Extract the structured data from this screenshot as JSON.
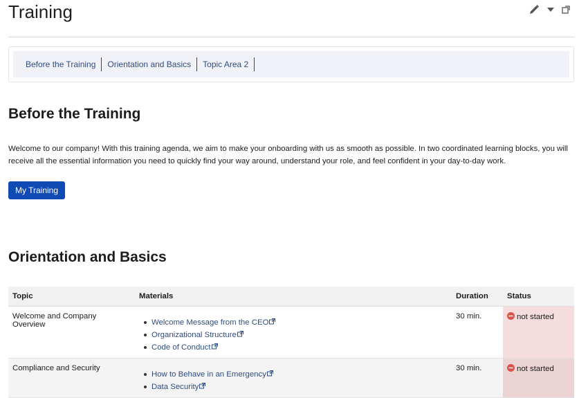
{
  "page": {
    "title": "Training"
  },
  "toc": {
    "items": [
      "Before the Training",
      "Orientation and Basics",
      "Topic Area 2"
    ]
  },
  "before": {
    "heading": "Before the Training",
    "intro": "Welcome to our company! With this training agenda, we aim to make your onboarding with us as smooth as possible. In two coordinated learning blocks, you will receive all the essential information you need to quickly find your way around, understand your role, and feel confident in your day-to-day work.",
    "button_label": "My Training"
  },
  "orientation": {
    "heading": "Orientation and Basics",
    "columns": {
      "topic": "Topic",
      "materials": "Materials",
      "duration": "Duration",
      "status": "Status"
    },
    "rows": [
      {
        "topic": "Welcome and Company Overview",
        "materials": [
          "Welcome Message from the CEO",
          "Organizational Structure",
          "Code of Conduct"
        ],
        "duration": "30 min.",
        "status": "not started"
      },
      {
        "topic": "Compliance and Security",
        "materials": [
          "How to Behave in an Emergency",
          "Data Security"
        ],
        "duration": "30 min.",
        "status": "not started"
      }
    ]
  },
  "icons": {
    "edit": "pencil-icon",
    "menu": "caret-down-icon",
    "expand": "expand-icon",
    "external": "external-link-icon",
    "status": "minus-circle-icon"
  },
  "colors": {
    "primary": "#0f4ab5",
    "link": "#2f4c7e",
    "status_bg": "#f5dcdd",
    "status_icon": "#d9534f"
  }
}
